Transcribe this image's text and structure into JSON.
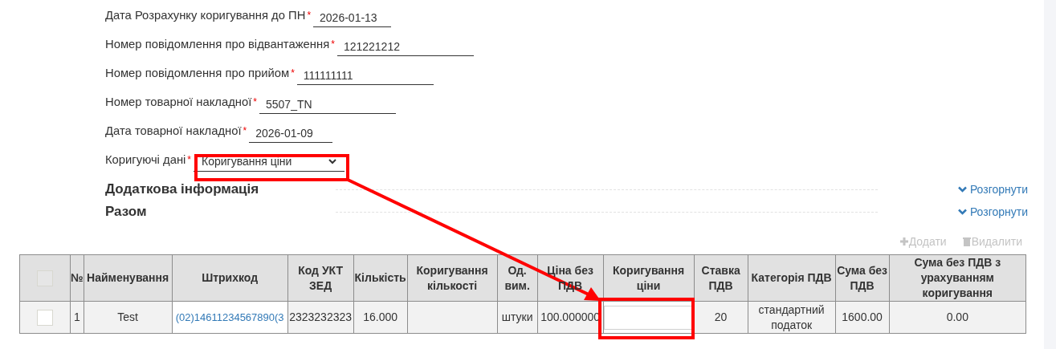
{
  "fields": [
    {
      "label": "Дата Розрахунку коригування до ПН",
      "required": true,
      "kind": "text",
      "value": "2026-01-13"
    },
    {
      "label": "Номер повідомлення про відвантаження",
      "required": true,
      "kind": "text",
      "value": "121221212"
    },
    {
      "label": "Номер повідомлення про прийом",
      "required": true,
      "kind": "text",
      "value": "111111111"
    },
    {
      "label": "Номер товарної накладної",
      "required": true,
      "kind": "text",
      "value": "5507_TN"
    },
    {
      "label": "Дата товарної накладної",
      "required": true,
      "kind": "text",
      "value": "2026-01-09"
    },
    {
      "label": "Коригуючі дані",
      "required": true,
      "kind": "select",
      "value": "Коригування ціни"
    }
  ],
  "required_mark": "*",
  "sections": [
    {
      "title": "Додаткова інформація",
      "toggle": "Розгорнути"
    },
    {
      "title": "Разом",
      "toggle": "Розгорнути"
    }
  ],
  "table_actions": [
    {
      "kind": "add",
      "label": "Додати",
      "disabled": true
    },
    {
      "kind": "delete",
      "label": "Видалити",
      "disabled": true
    }
  ],
  "table": {
    "select_all": {
      "checked": false,
      "disabled": true
    },
    "columns": [
      "№",
      "Найменування",
      "Штрихкод",
      "Код УКТ ЗЕД",
      "Кількість",
      "Коригування кількості",
      "Од. вим.",
      "Ціна без ПДВ",
      "Коригування ціни",
      "Ставка ПДВ",
      "Категорія ПДВ",
      "Сума без ПДВ",
      "Сума без ПДВ з урахуванням коригування"
    ],
    "rows": [
      {
        "checked": false,
        "cells": [
          {
            "kind": "text",
            "value": "1"
          },
          {
            "kind": "text",
            "value": "Test"
          },
          {
            "kind": "link",
            "value": "(02)14611234567890(3"
          },
          {
            "kind": "text",
            "value": "2323232323"
          },
          {
            "kind": "text",
            "value": "16.000"
          },
          {
            "kind": "empty"
          },
          {
            "kind": "text",
            "value": "штуки"
          },
          {
            "kind": "text",
            "value": "100.000000"
          },
          {
            "kind": "input"
          },
          {
            "kind": "text",
            "value": "20"
          },
          {
            "kind": "text",
            "value": "стандартний податок"
          },
          {
            "kind": "text",
            "value": "1600.00"
          },
          {
            "kind": "text",
            "value": "0.00"
          }
        ]
      }
    ]
  }
}
